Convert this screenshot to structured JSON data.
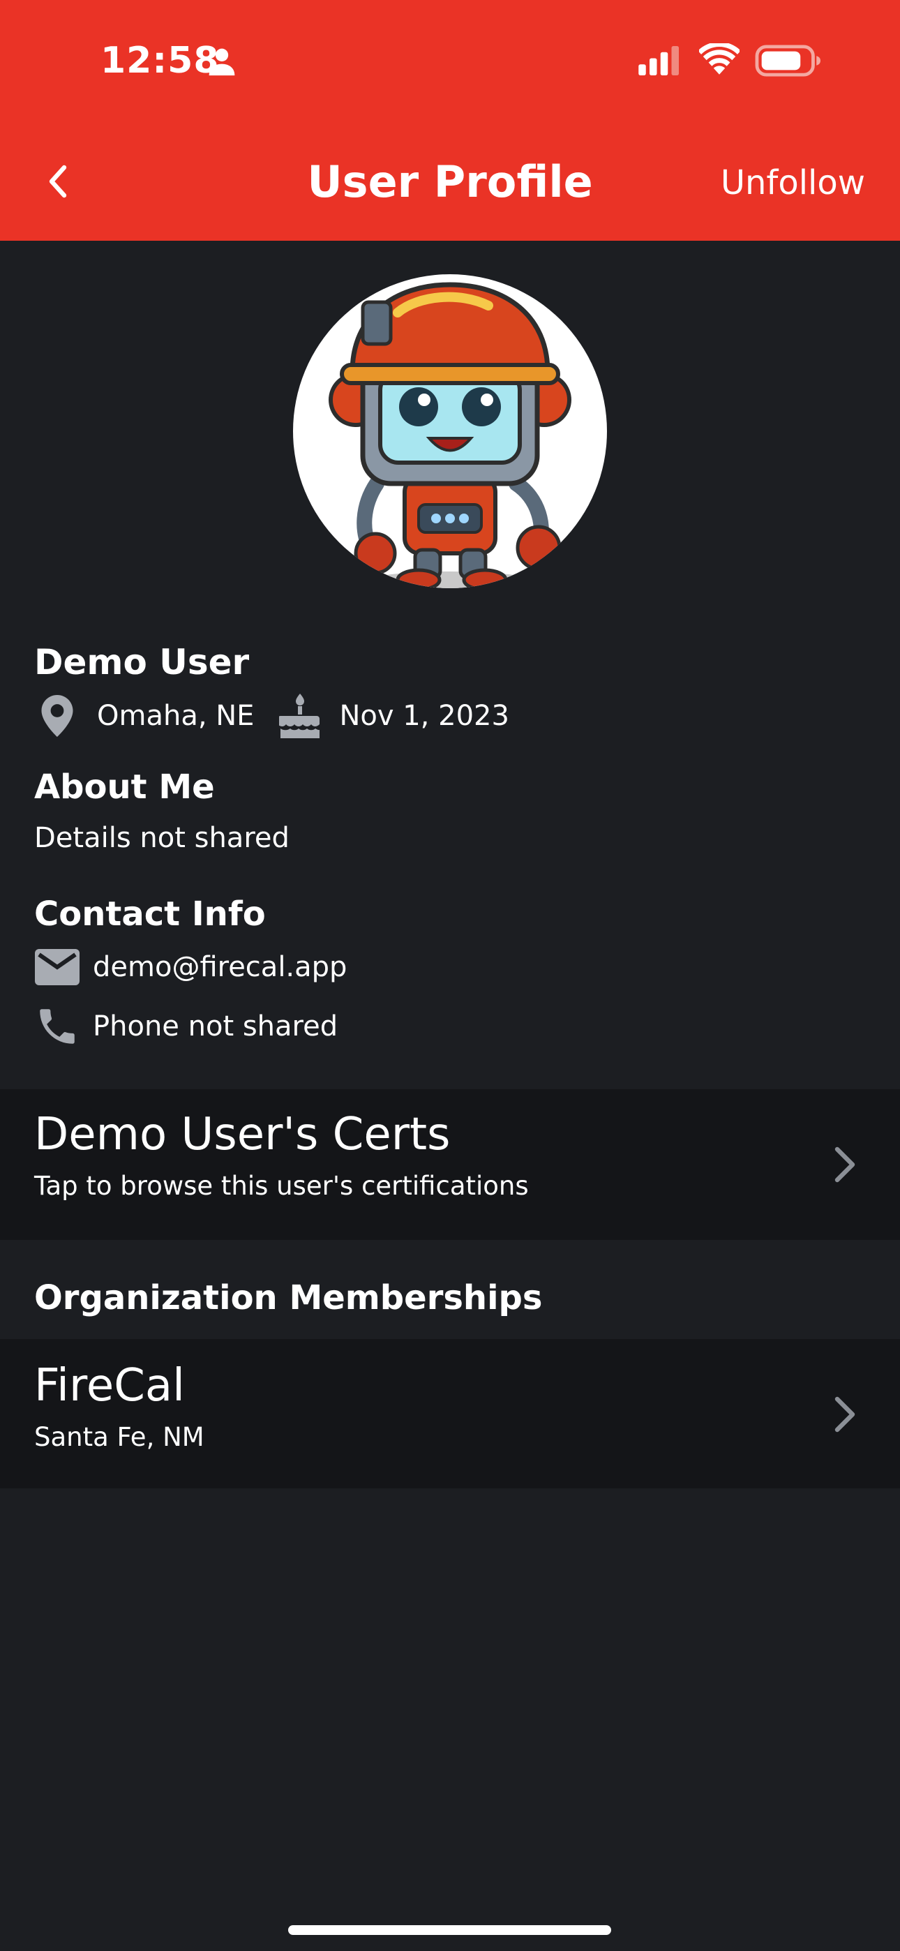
{
  "status_bar": {
    "time": "12:58",
    "icons": [
      "person-icon",
      "signal-icon",
      "wifi-icon",
      "battery-icon"
    ]
  },
  "header": {
    "title": "User Profile",
    "back_icon": "chevron-left-icon",
    "unfollow_label": "Unfollow",
    "color": "#ea3326"
  },
  "profile": {
    "avatar": "firefighter-robot-avatar",
    "name": "Demo User",
    "location": "Omaha, NE",
    "date": "Nov 1, 2023"
  },
  "about": {
    "heading": "About Me",
    "text": "Details not shared"
  },
  "contact": {
    "heading": "Contact Info",
    "email": "demo@firecal.app",
    "phone": "Phone not shared"
  },
  "certs_card": {
    "title": "Demo User's Certs",
    "subtitle": "Tap to browse this user's certifications"
  },
  "organizations": {
    "heading": "Organization Memberships",
    "items": [
      {
        "name": "FireCal",
        "location": "Santa Fe, NM"
      }
    ]
  },
  "colors": {
    "background": "#1c1e22",
    "card_background": "#141518",
    "icon_gray": "#a8acb3"
  }
}
